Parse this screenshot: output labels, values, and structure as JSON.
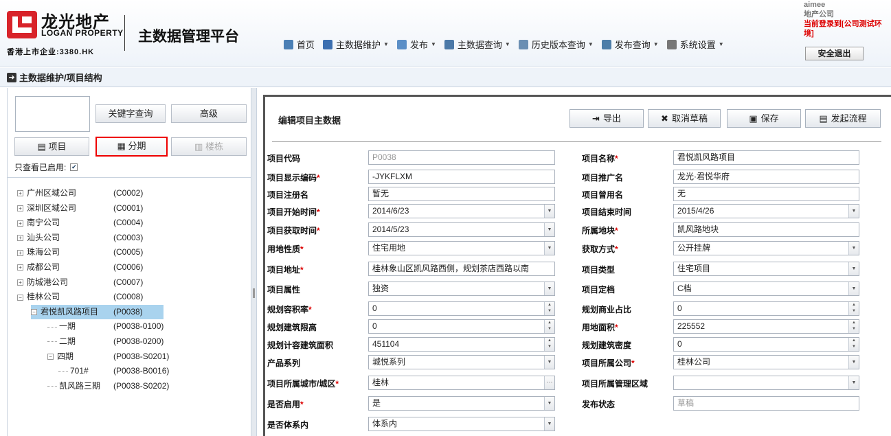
{
  "header": {
    "logo_cn": "龙光地产",
    "logo_en": "LOGAN PROPERTY",
    "logo_hk": "香港上市企业:3380.HK",
    "platform": "主数据管理平台",
    "nav": [
      {
        "label": "首页",
        "icon": "home-icon",
        "color": "#4a7fb5"
      },
      {
        "label": "主数据维护",
        "icon": "data-maintain-icon",
        "color": "#3c6fb0"
      },
      {
        "label": "发布",
        "icon": "publish-icon",
        "color": "#5b8fc7"
      },
      {
        "label": "主数据查询",
        "icon": "data-query-icon",
        "color": "#4b79a8"
      },
      {
        "label": "历史版本查询",
        "icon": "history-icon",
        "color": "#6b8fb3"
      },
      {
        "label": "发布查询",
        "icon": "publish-query-icon",
        "color": "#4d7ea8"
      },
      {
        "label": "系统设置",
        "icon": "settings-icon",
        "color": "#777777"
      }
    ],
    "user_name": "aimee",
    "user_company": "地产公司",
    "login_env": "当前登录到[公司测试环境]",
    "logout": "安全退出"
  },
  "breadcrumb": "主数据维护/项目结构",
  "left": {
    "keyword_search": "关键字查询",
    "advanced": "高级",
    "tab_project": "项目",
    "tab_phase": "分期",
    "tab_building": "楼栋",
    "filter_label": "只查看已启用:",
    "filter_checked": true,
    "tree": [
      {
        "name": "广州区域公司",
        "code": "(C0002)",
        "level": 0,
        "toggle": "+"
      },
      {
        "name": "深圳区域公司",
        "code": "(C0001)",
        "level": 0,
        "toggle": "+"
      },
      {
        "name": "南宁公司",
        "code": "(C0004)",
        "level": 0,
        "toggle": "+"
      },
      {
        "name": "汕头公司",
        "code": "(C0003)",
        "level": 0,
        "toggle": "+"
      },
      {
        "name": "珠海公司",
        "code": "(C0005)",
        "level": 0,
        "toggle": "+"
      },
      {
        "name": "成都公司",
        "code": "(C0006)",
        "level": 0,
        "toggle": "+"
      },
      {
        "name": "防城港公司",
        "code": "(C0007)",
        "level": 0,
        "toggle": "+"
      },
      {
        "name": "桂林公司",
        "code": "(C0008)",
        "level": 0,
        "toggle": "-"
      },
      {
        "name": "君悦凯风路项目",
        "code": "(P0038)",
        "level": 1,
        "toggle": "-",
        "selected": true
      },
      {
        "name": "一期",
        "code": "(P0038-0100)",
        "level": 2,
        "toggle": ""
      },
      {
        "name": "二期",
        "code": "(P0038-0200)",
        "level": 2,
        "toggle": ""
      },
      {
        "name": "四期",
        "code": "(P0038-S0201)",
        "level": 2,
        "toggle": "-"
      },
      {
        "name": "701#",
        "code": "(P0038-B0016)",
        "level": 3,
        "toggle": ""
      },
      {
        "name": "凯风路三期",
        "code": "(P0038-S0202)",
        "level": 2,
        "toggle": ""
      }
    ]
  },
  "form": {
    "title": "编辑项目主数据",
    "buttons": [
      {
        "label": "导出",
        "icon": "export-icon",
        "glyph": "⇥"
      },
      {
        "label": "取消草稿",
        "icon": "cancel-draft-icon",
        "glyph": "✖"
      },
      {
        "label": "保存",
        "icon": "save-icon",
        "glyph": "▣"
      },
      {
        "label": "发起流程",
        "icon": "start-process-icon",
        "glyph": "▤"
      }
    ],
    "left_fields": [
      {
        "label": "项目代码",
        "req": false,
        "value": "P0038",
        "type": "readonly"
      },
      {
        "label": "项目显示编码",
        "req": true,
        "value": "-JYKFLXM",
        "type": "text"
      },
      {
        "label": "项目注册名",
        "req": false,
        "value": "暂无",
        "type": "text"
      },
      {
        "label": "项目开始时间",
        "req": true,
        "value": "2014/6/23",
        "type": "select"
      },
      {
        "label": "项目获取时间",
        "req": true,
        "value": "2014/5/23",
        "type": "select"
      },
      {
        "label": "用地性质",
        "req": true,
        "value": "住宅用地",
        "type": "select"
      },
      {
        "label": "项目地址",
        "req": true,
        "value": "桂林象山区凯风路西侧，规划茶店西路以南",
        "type": "text"
      },
      {
        "label": "项目属性",
        "req": false,
        "value": "独资",
        "type": "select"
      },
      {
        "label": "规划容积率",
        "req": true,
        "value": "0",
        "type": "spin"
      },
      {
        "label": "规划建筑限高",
        "req": false,
        "value": "0",
        "type": "spin"
      },
      {
        "label": "规划计容建筑面积",
        "req": false,
        "value": "451104",
        "type": "spin"
      },
      {
        "label": "产品系列",
        "req": false,
        "value": "城悦系列",
        "type": "select"
      },
      {
        "label": "项目所属城市/城区",
        "req": true,
        "value": "桂林",
        "type": "more"
      },
      {
        "label": "是否启用",
        "req": true,
        "value": "是",
        "type": "select"
      },
      {
        "label": "是否体系内",
        "req": false,
        "value": "体系内",
        "type": "select"
      }
    ],
    "right_fields": [
      {
        "label": "项目名称",
        "req": true,
        "value": "君悦凯风路项目",
        "type": "text"
      },
      {
        "label": "项目推广名",
        "req": false,
        "value": "龙光·君悦华府",
        "type": "text"
      },
      {
        "label": "项目曾用名",
        "req": false,
        "value": "无",
        "type": "text"
      },
      {
        "label": "项目结束时间",
        "req": false,
        "value": "2015/4/26",
        "type": "select"
      },
      {
        "label": "所属地块",
        "req": true,
        "value": "凯风路地块",
        "type": "text"
      },
      {
        "label": "获取方式",
        "req": true,
        "value": "公开挂牌",
        "type": "select"
      },
      {
        "label": "项目类型",
        "req": false,
        "value": "住宅项目",
        "type": "select"
      },
      {
        "label": "项目定档",
        "req": false,
        "value": "C档",
        "type": "select"
      },
      {
        "label": "规划商业占比",
        "req": false,
        "value": "0",
        "type": "spin"
      },
      {
        "label": "用地面积",
        "req": true,
        "value": "225552",
        "type": "spin"
      },
      {
        "label": "规划建筑密度",
        "req": false,
        "value": "0",
        "type": "spin"
      },
      {
        "label": "项目所属公司",
        "req": true,
        "value": "桂林公司",
        "type": "select"
      },
      {
        "label": "项目所属管理区域",
        "req": false,
        "value": "",
        "type": "select"
      },
      {
        "label": "发布状态",
        "req": false,
        "value": "草稿",
        "type": "readonly"
      }
    ]
  }
}
